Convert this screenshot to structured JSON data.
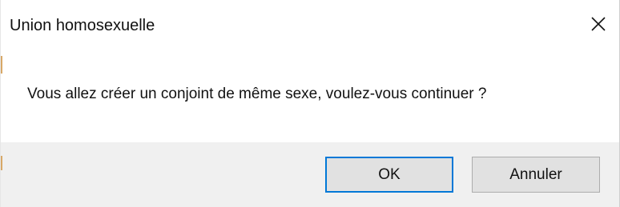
{
  "dialog": {
    "title": "Union homosexuelle",
    "close_icon": "close-icon",
    "message": "Vous allez créer un conjoint de même sexe, voulez-vous continuer ?",
    "buttons": {
      "ok_label": "OK",
      "cancel_label": "Annuler"
    },
    "colors": {
      "background": "#ffffff",
      "footer": "#f0f0f0",
      "button_face": "#e1e1e1",
      "default_button_border": "#0078d7",
      "text": "#111111"
    }
  }
}
